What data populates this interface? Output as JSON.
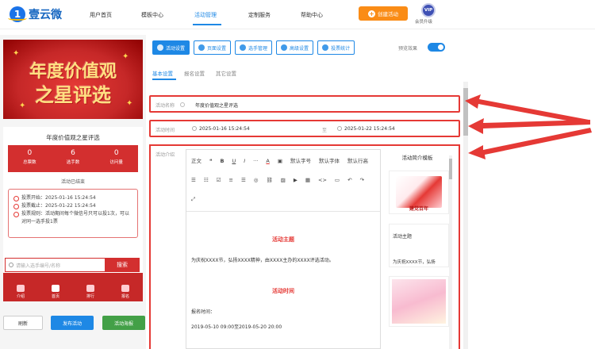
{
  "brand": {
    "name": "壹云微"
  },
  "nav": [
    "用户首页",
    "模板中心",
    "活动管理",
    "定制服务",
    "帮助中心"
  ],
  "create_button": "创建活动",
  "vip": {
    "badge": "VIP",
    "label": "会员升级"
  },
  "banner": {
    "line1": "年度价值观",
    "line2": "之星评选"
  },
  "card": {
    "title": "年度价值观之星评选",
    "stats": [
      {
        "value": "0",
        "label": "总票数"
      },
      {
        "value": "6",
        "label": "选手数"
      },
      {
        "value": "0",
        "label": "访问量"
      }
    ],
    "status": "活动已结束",
    "info": [
      "投票开始：2025-01-16 15:24:54",
      "投票截止：2025-01-22 15:24:54",
      "投票规则：活动期间每个微信号只可以投1次，可以对同一选手投1票"
    ]
  },
  "search": {
    "placeholder": "请输入选手编号/名称",
    "button": "搜索"
  },
  "tabbar": [
    "介绍",
    "首页",
    "排行",
    "报名"
  ],
  "bottom_buttons": [
    "刷新",
    "发布活动",
    "活动海报"
  ],
  "toolbar": [
    "活动设置",
    "页面设置",
    "选手管理",
    "高级设置",
    "投票统计"
  ],
  "preview_label": "预览效果",
  "subtabs": [
    "基本设置",
    "报名设置",
    "其它设置"
  ],
  "form": {
    "name_label": "活动名称",
    "name_value": "年度价值观之星评选",
    "time_label": "活动时间",
    "start": "2025-01-16 15:24:54",
    "to": "至",
    "end": "2025-01-22 15:24:54",
    "intro_label": "活动介绍"
  },
  "editor": {
    "toolbar": [
      "正文",
      "❝",
      "B",
      "U",
      "I",
      "···",
      "A",
      "▣",
      "默认字号",
      "默认字体",
      "默认行高",
      "☰",
      "☷",
      "☑",
      "≡",
      "☰",
      "◎",
      "⛓",
      "▨",
      "▶",
      "▦",
      "<>",
      "▭",
      "↶",
      "↷",
      "⤢"
    ],
    "h1": "活动主题",
    "p1": "为庆祝XXXX节，弘扬XXXX精神，由XXXX主办的XXXX评选活动。",
    "h2": "活动时间",
    "p2": "报名时间：",
    "p3": "2019-05-10 09:00至2019-05-20 20:00"
  },
  "templates": {
    "title": "活动简介模板",
    "t1": "建党百年",
    "t2": "活动主题",
    "t3": "为庆祝XXXX节，弘扬"
  }
}
